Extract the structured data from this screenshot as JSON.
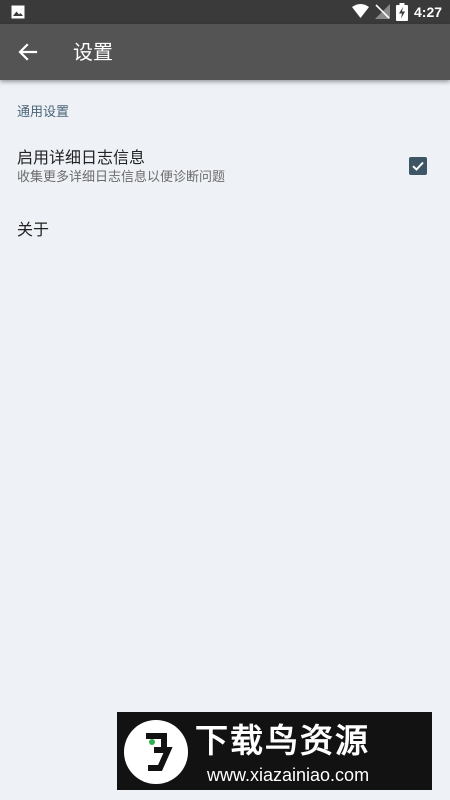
{
  "status_bar": {
    "time": "4:27",
    "icons": [
      "image-notification-icon",
      "wifi-icon",
      "no-signal-icon",
      "battery-charging-icon"
    ]
  },
  "app_bar": {
    "back_icon": "arrow-left-icon",
    "title": "设置"
  },
  "settings": {
    "section_header": "通用设置",
    "verbose_logging": {
      "title": "启用详细日志信息",
      "summary": "收集更多详细日志信息以便诊断问题",
      "checked": true
    },
    "about": {
      "title": "关于"
    }
  },
  "watermark": {
    "brand": "下载鸟资源",
    "url": "www.xiazainiao.com"
  },
  "colors": {
    "status_bar": "#3a3a3a",
    "app_bar": "#545454",
    "background": "#eef1f6",
    "accent": "#3e5566",
    "section_header": "#4a6477"
  }
}
